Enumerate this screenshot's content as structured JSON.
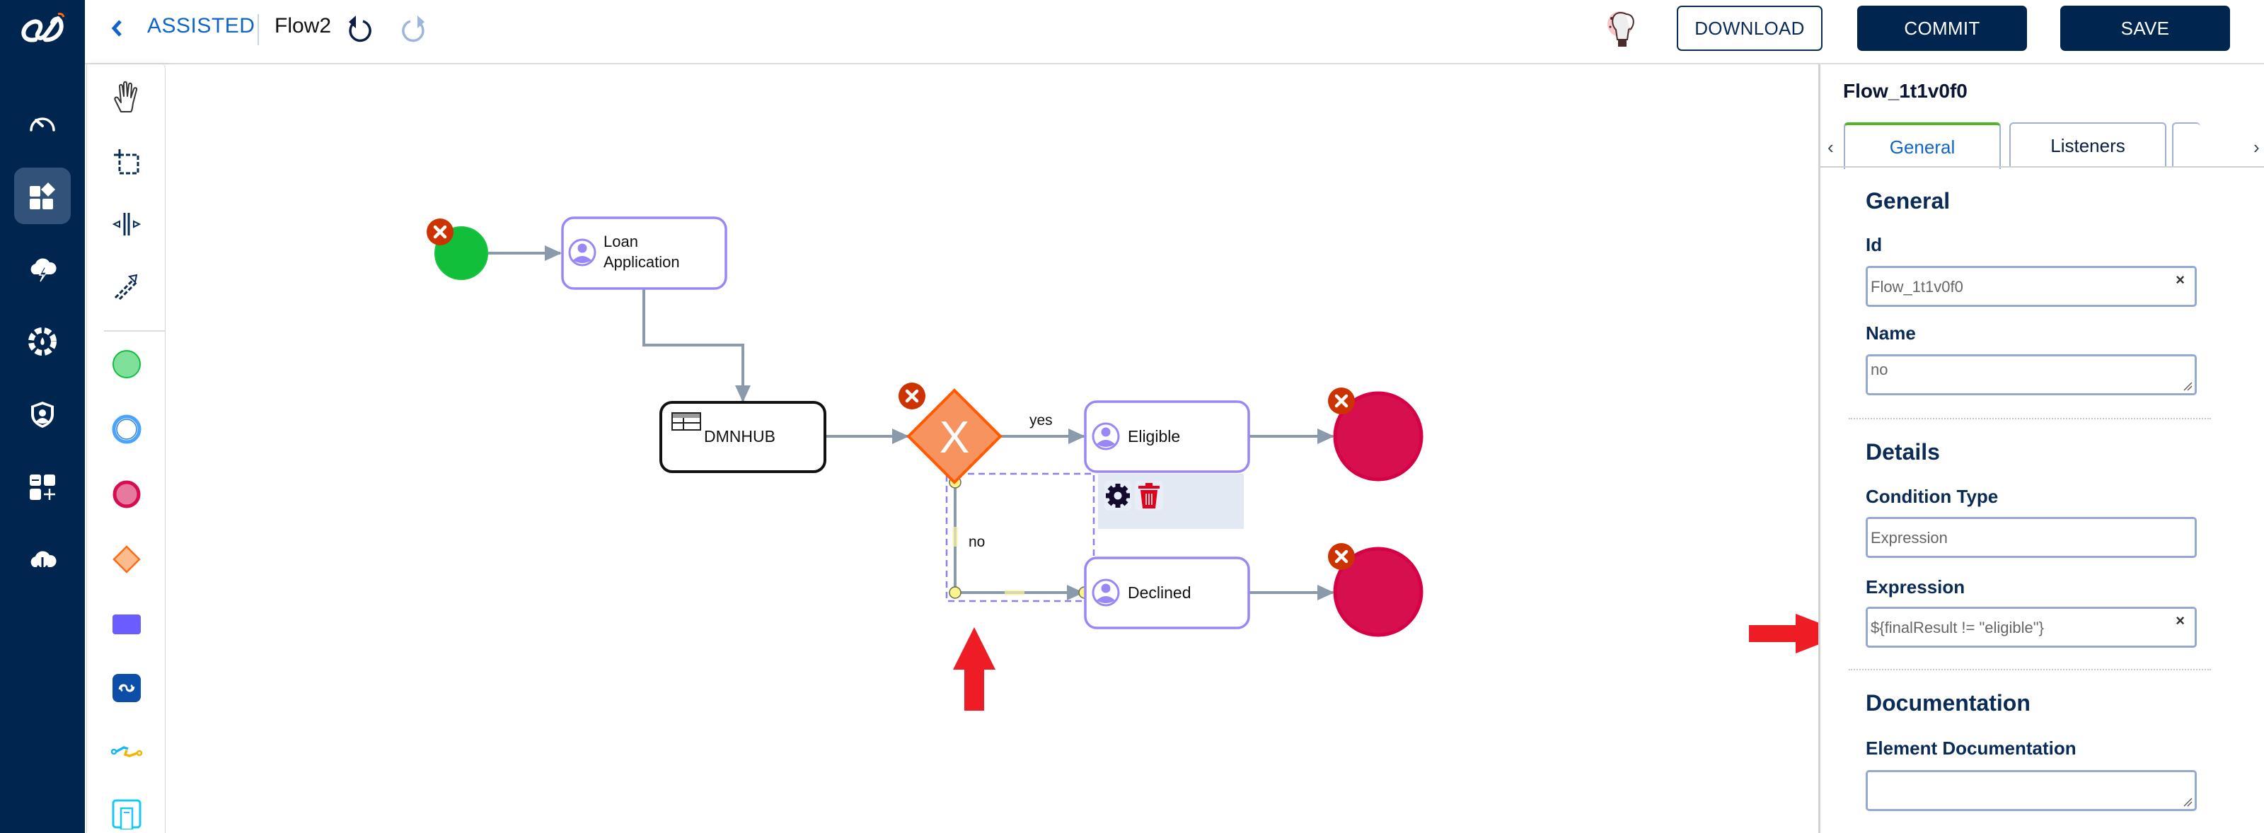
{
  "app": {
    "breadcrumb": "ASSISTED",
    "flow_name": "Flow2"
  },
  "nav": {
    "items": [
      {
        "icon": "dashboard-gauge-icon"
      },
      {
        "icon": "apps-shapes-icon",
        "active": true
      },
      {
        "icon": "cloud-bolt-icon"
      },
      {
        "icon": "settings-wheel-icon"
      },
      {
        "icon": "user-shield-icon"
      },
      {
        "icon": "add-widget-icon"
      },
      {
        "icon": "cloud-download-icon"
      }
    ]
  },
  "toolbar": {
    "download_label": "DOWNLOAD",
    "commit_label": "COMMIT",
    "save_label": "SAVE"
  },
  "palette": {
    "tools": [
      "hand-tool",
      "lasso-tool",
      "space-tool",
      "connect-tool"
    ],
    "shapes": [
      "start-event",
      "intermediate-event",
      "end-event",
      "gateway",
      "task",
      "subprocess",
      "connector",
      "data-object"
    ]
  },
  "diagram": {
    "nodes": {
      "start": {
        "type": "start-event"
      },
      "loan_application": {
        "type": "user-task",
        "label_line1": "Loan",
        "label_line2": "Application"
      },
      "dmnhub": {
        "type": "business-rule-task",
        "label": "DMNHUB"
      },
      "gateway": {
        "type": "exclusive-gateway",
        "symbol": "X"
      },
      "eligible": {
        "type": "user-task",
        "label": "Eligible"
      },
      "declined": {
        "type": "user-task",
        "label": "Declined"
      },
      "end1": {
        "type": "end-event"
      },
      "end2": {
        "type": "end-event"
      }
    },
    "flows": {
      "yes_label": "yes",
      "no_label": "no"
    },
    "colors": {
      "start": "#12bf3a",
      "task_border": "#9b86f5",
      "gateway_fill": "#f7935e",
      "gateway_border": "#ff5a00",
      "end": "#d50e4f",
      "error_badge": "#cc3300",
      "edge": "#8a9aab"
    }
  },
  "properties": {
    "title": "Flow_1t1v0f0",
    "tabs": [
      {
        "label": "General",
        "active": true
      },
      {
        "label": "Listeners",
        "active": false
      }
    ],
    "general_heading": "General",
    "id_label": "Id",
    "id_value": "Flow_1t1v0f0",
    "name_label": "Name",
    "name_value": "no",
    "details_heading": "Details",
    "condition_type_label": "Condition Type",
    "condition_type_value": "Expression",
    "expression_label": "Expression",
    "expression_value": "${finalResult != \"eligible\"}",
    "documentation_heading": "Documentation",
    "element_documentation_label": "Element Documentation",
    "element_documentation_value": ""
  }
}
